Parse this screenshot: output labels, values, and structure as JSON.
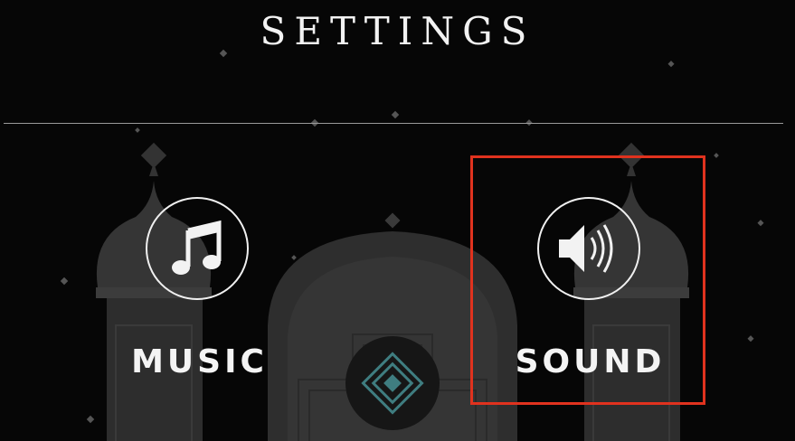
{
  "header": {
    "title": "SETTINGS"
  },
  "options": {
    "music": {
      "label": "MUSIC",
      "icon": "music-note-icon"
    },
    "sound": {
      "label": "SOUND",
      "icon": "speaker-icon"
    }
  },
  "colors": {
    "background": "#060606",
    "palace": "#2f2f2f",
    "text": "#f2f2f2",
    "highlight": "#e0321e",
    "emblem": "#3f7d80"
  }
}
